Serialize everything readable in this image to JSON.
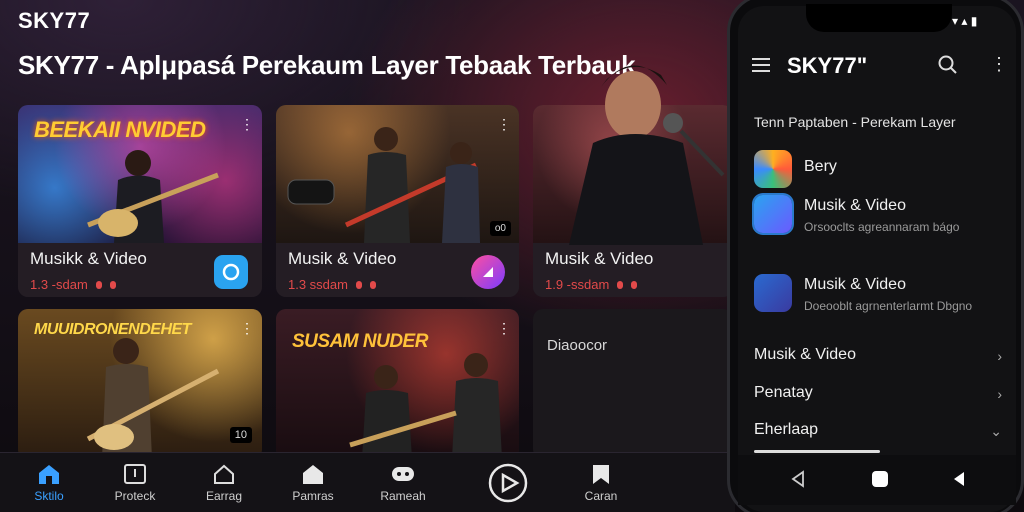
{
  "brand": "SKY77",
  "headline": "SKY77 - Aplμpasá Perekaum Layer Tebaak Terbauk",
  "cards": [
    {
      "banner": "BEEKAII NVIDED",
      "title": "Musikk & Video",
      "meta": "1.3 -sdam",
      "icon": "record-icon",
      "badge": ""
    },
    {
      "banner": "",
      "title": "Musik & Video",
      "meta": "1.3 ssdam",
      "icon": "gradient-play-icon",
      "badge": "o0"
    },
    {
      "banner": "",
      "title": "Musik & Video",
      "meta": "1.9 -ssdam",
      "icon": "",
      "badge": ""
    },
    {
      "banner": "MUUIDRONENDEHET",
      "title": "",
      "meta": "",
      "icon": "",
      "badge": "10"
    },
    {
      "banner": "SUSAM NUDER",
      "title": "",
      "meta": "",
      "icon": "",
      "badge": ""
    },
    {
      "banner": "",
      "title": "Diaoocor",
      "meta": "",
      "icon": "",
      "badge": ""
    }
  ],
  "bottom_nav": [
    {
      "label": "Sktilo",
      "icon": "home-icon",
      "active": true
    },
    {
      "label": "Proteck",
      "icon": "upload-box-icon",
      "active": false
    },
    {
      "label": "Earrag",
      "icon": "home-outline-icon",
      "active": false
    },
    {
      "label": "Pamras",
      "icon": "house-icon",
      "active": false
    },
    {
      "label": "Rameah",
      "icon": "gamepad-icon",
      "active": false
    },
    {
      "label": "",
      "icon": "play-circle-icon",
      "active": false
    },
    {
      "label": "Caran",
      "icon": "bookmark-icon",
      "active": false
    }
  ],
  "phone": {
    "title": "SKY77\"",
    "subtitle": "Tenn Paptaben - Perekam Layer",
    "apps": [
      {
        "name": "Bery",
        "desc": "",
        "icon": "multicolor-app-icon"
      },
      {
        "name": "Musik & Video",
        "desc": "Orsooclts agreannaram bágo",
        "icon": "music-video-app-icon"
      },
      {
        "name": "Musik & Video",
        "desc": "Doeooblt agrnenterlarmt Dbgno",
        "icon": "music-video-app-icon"
      }
    ],
    "rows": [
      {
        "label": "Musik & Video",
        "chevron": "right"
      },
      {
        "label": "Penatay",
        "chevron": "right"
      },
      {
        "label": "Eherlaap",
        "chevron": "down"
      }
    ]
  },
  "colors": {
    "accent": "#3aa0ff",
    "red": "#e24a4a",
    "bg": "#141216"
  }
}
